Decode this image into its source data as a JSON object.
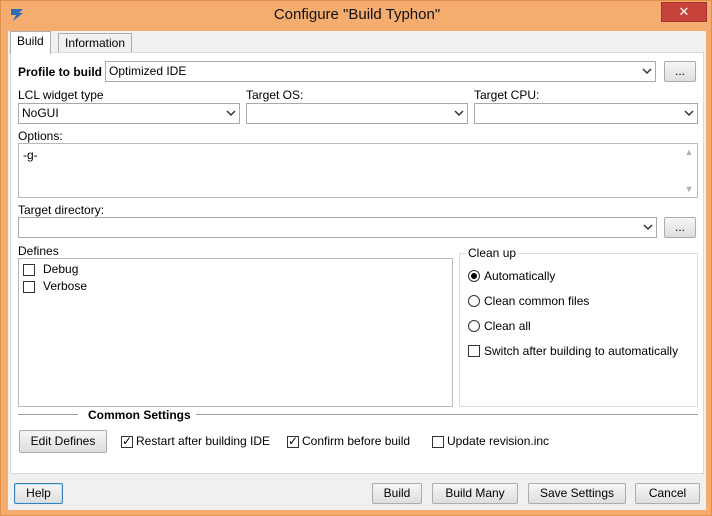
{
  "window": {
    "title": "Configure \"Build Typhon\"",
    "close_glyph": "✕"
  },
  "tabs": [
    {
      "label": "Build"
    },
    {
      "label": "Information"
    }
  ],
  "build": {
    "profile_label": "Profile to build",
    "profile_value": "Optimized IDE",
    "profile_more": "...",
    "lcl_label": "LCL widget type",
    "lcl_value": "NoGUI",
    "target_os_label": "Target OS:",
    "target_os_value": "",
    "target_cpu_label": "Target CPU:",
    "target_cpu_value": "",
    "options_label": "Options:",
    "options_value": "-g-",
    "target_dir_label": "Target directory:",
    "target_dir_value": "",
    "target_dir_more": "...",
    "defines_label": "Defines",
    "defines": [
      {
        "label": "Debug",
        "checked": false
      },
      {
        "label": "Verbose",
        "checked": false
      }
    ],
    "cleanup": {
      "caption": "Clean up",
      "options": [
        {
          "label": "Automatically",
          "selected": true
        },
        {
          "label": "Clean common files",
          "selected": false
        },
        {
          "label": "Clean all",
          "selected": false
        }
      ],
      "switch_label": "Switch after building to automatically"
    },
    "common_settings_label": "Common Settings",
    "edit_defines": "Edit Defines",
    "restart_label": "Restart after building IDE",
    "confirm_label": "Confirm before build",
    "update_label": "Update revision.inc"
  },
  "footer": {
    "help": "Help",
    "build": "Build",
    "build_many": "Build Many",
    "save_settings": "Save Settings",
    "cancel": "Cancel"
  },
  "colors": {
    "title_bar": "#f5ad6f",
    "close": "#c7423a",
    "panel": "#ffffff",
    "client": "#f0f0f0"
  },
  "icons": {
    "app": "typhon-app-icon",
    "dropdown": "chevron-down-icon",
    "check": "checkmark-icon"
  }
}
